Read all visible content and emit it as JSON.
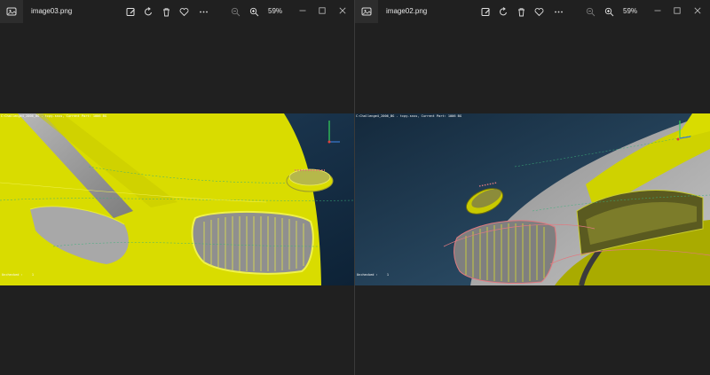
{
  "windows": [
    {
      "file_name": "image03.png",
      "zoom": "59%",
      "viewport": {
        "header": "C:Challenge4_2006_BG - tcpy.ssss, Current Part: 1006 BG",
        "status_label": "Unchecked :",
        "status_value": "1"
      }
    },
    {
      "file_name": "image02.png",
      "zoom": "59%",
      "viewport": {
        "header": "C:Challenge4_2006_BG - tcpy.ssss, Current Part: 1006 BG",
        "status_label": "Unchecked :",
        "status_value": "1"
      }
    }
  ],
  "toolbar": {
    "icons": [
      "edit-image-icon",
      "rotate-icon",
      "delete-icon",
      "favorite-icon",
      "more-icon",
      "zoom-out-icon",
      "zoom-in-icon"
    ]
  },
  "window_controls": [
    "minimize-icon",
    "maximize-icon",
    "close-icon"
  ],
  "colors": {
    "body_yellow": "#d9dc00",
    "grille_grey": "#9b9b9b",
    "background_blue": "#18334a",
    "window_chrome": "#202020"
  }
}
